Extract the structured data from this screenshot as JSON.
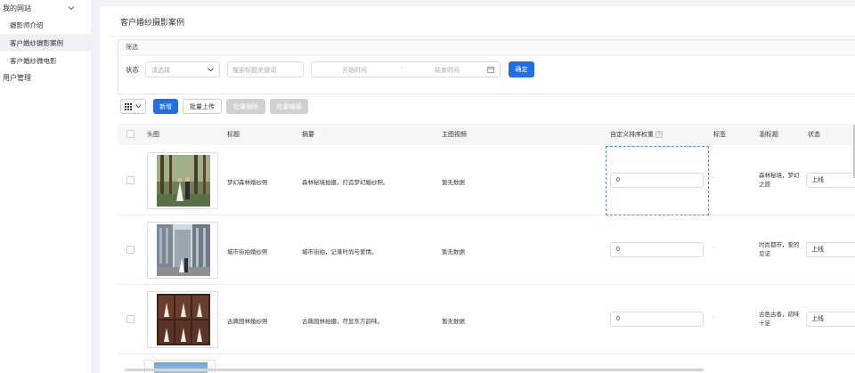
{
  "sidebar": {
    "group_website": "我的网站",
    "items": [
      {
        "label": "摄影师介绍"
      },
      {
        "label": "客户婚纱摄影案例"
      },
      {
        "label": "客户婚纱微电影"
      }
    ],
    "group_users": "用户管理"
  },
  "page": {
    "title": "客户婚纱摄影案例"
  },
  "filter": {
    "heading": "筛选",
    "status_label": "状态",
    "status_placeholder": "请选择",
    "keyword_placeholder": "搜索标题关键词",
    "start_placeholder": "开始时间",
    "range_sep": "-",
    "end_placeholder": "结束时间",
    "confirm": "确定"
  },
  "toolbar": {
    "new": "新增",
    "batch_upload": "批量上传",
    "batch_delete": "批量删除",
    "batch_edit": "批量编辑"
  },
  "table": {
    "headers": {
      "image": "头图",
      "title": "标题",
      "summary": "摘要",
      "video": "主图视频",
      "order": "自定义排序权重",
      "order_help": "?",
      "tags": "标签",
      "subtitle": "副标题",
      "status": "状态"
    },
    "rows": [
      {
        "title": "梦幻森林婚纱照",
        "summary": "森林秘境拍摄，打造梦幻婚纱照。",
        "video": "暂无数据",
        "order": "0",
        "tags": "-",
        "subtitle": "森林秘境，梦幻之旅",
        "status": "上线"
      },
      {
        "title": "城市街拍婚纱照",
        "summary": "城市街拍，记录时尚与爱情。",
        "video": "暂无数据",
        "order": "0",
        "tags": "-",
        "subtitle": "时尚都市，爱的见证",
        "status": "上线"
      },
      {
        "title": "古典园林婚纱照",
        "summary": "古典园林拍摄，尽显东方韵味。",
        "video": "暂无数据",
        "order": "0",
        "tags": "-",
        "subtitle": "古色古香，韵味十足",
        "status": "上线"
      }
    ]
  },
  "colors": {
    "primary": "#1e6fe8",
    "disabled": "#d0d0d0",
    "focus_border": "#4c8ef5"
  }
}
